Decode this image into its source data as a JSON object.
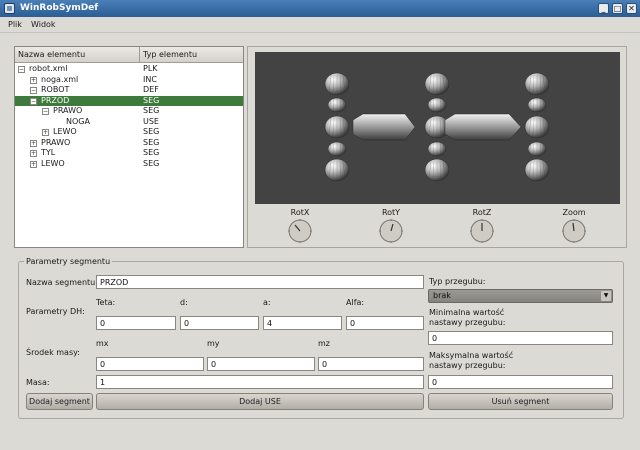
{
  "window": {
    "title": "WinRobSymDef",
    "minimize_glyph": "_",
    "maximize_glyph": "□",
    "close_glyph": "✕"
  },
  "menu": {
    "items": [
      "Plik",
      "Widok"
    ]
  },
  "tree": {
    "headers": [
      "Nazwa elementu",
      "Typ elementu"
    ],
    "rows": [
      {
        "name": "robot.xml",
        "type": "PLK",
        "depth": 0,
        "expander": "−",
        "selected": false
      },
      {
        "name": "noga.xml",
        "type": "INC",
        "depth": 1,
        "expander": "+",
        "selected": false
      },
      {
        "name": "ROBOT",
        "type": "DEF",
        "depth": 1,
        "expander": "−",
        "selected": false
      },
      {
        "name": "PRZOD",
        "type": "SEG",
        "depth": 2,
        "expander": "−",
        "selected": true
      },
      {
        "name": "PRAWO",
        "type": "SEG",
        "depth": 3,
        "expander": "−",
        "selected": false
      },
      {
        "name": "NOGA",
        "type": "USE",
        "depth": 4,
        "expander": "",
        "selected": false
      },
      {
        "name": "LEWO",
        "type": "SEG",
        "depth": 3,
        "expander": "+",
        "selected": false
      },
      {
        "name": "PRAWO",
        "type": "SEG",
        "depth": 2,
        "expander": "+",
        "selected": false
      },
      {
        "name": "TYL",
        "type": "SEG",
        "depth": 2,
        "expander": "+",
        "selected": false
      },
      {
        "name": "LEWO",
        "type": "SEG",
        "depth": 2,
        "expander": "+",
        "selected": false
      }
    ]
  },
  "view": {
    "dials": [
      "RotX",
      "RotY",
      "RotZ",
      "Zoom"
    ]
  },
  "segment": {
    "group_title": "Parametry segmentu",
    "name_label": "Nazwa segmentu:",
    "name_value": "PRZOD",
    "dh_label": "Parametry DH:",
    "dh_headers": [
      "Teta:",
      "d:",
      "a:",
      "Alfa:"
    ],
    "dh_values": [
      "0",
      "0",
      "4",
      "0"
    ],
    "mass_center_label": "Środek masy:",
    "mass_center_headers": [
      "mx",
      "my",
      "mz"
    ],
    "mass_center_values": [
      "0",
      "0",
      "0"
    ],
    "mass_label": "Masa:",
    "mass_value": "1",
    "joint_type_label": "Typ przegubu:",
    "joint_type_value": "brak",
    "min_label_1": "Minimalna wartość",
    "min_label_2": "nastawy przegubu:",
    "min_value": "0",
    "max_label_1": "Maksymalna wartość",
    "max_label_2": "nastawy przegubu:",
    "max_value": "0"
  },
  "buttons": {
    "add_segment": "Dodaj segment",
    "add_use": "Dodaj USE",
    "remove_segment": "Usuń segment"
  }
}
